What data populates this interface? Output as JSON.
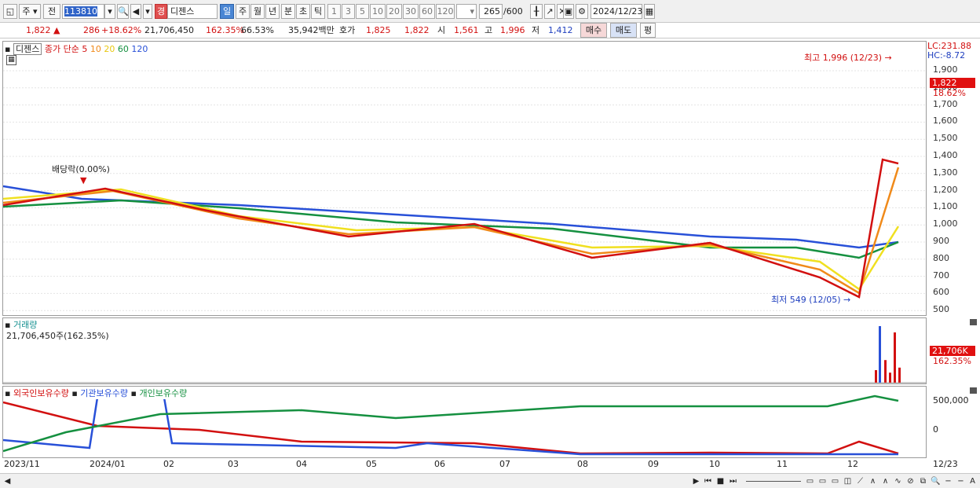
{
  "toolbar": {
    "mode1": "주",
    "mode2": "전",
    "code": "113810",
    "badge": "경",
    "stock_name": "디젠스",
    "periods": [
      "일",
      "주",
      "월",
      "년",
      "분",
      "초",
      "틱"
    ],
    "intervals": [
      "1",
      "3",
      "5",
      "10",
      "20",
      "30",
      "60",
      "120"
    ],
    "count": "265",
    "count_max": "/600",
    "date": "2024/12/23"
  },
  "quote": {
    "price": "1,822",
    "change": "286",
    "change_pct": "+18.62%",
    "volume": "21,706,450",
    "vol_ratio": "162.35%",
    "turnover": "66.53%",
    "amount": "35,942백만",
    "ask_label": "호가",
    "ask": "1,825",
    "bid": "1,822",
    "open_label": "시",
    "open": "1,561",
    "high_label": "고",
    "high": "1,996",
    "low_label": "저",
    "low": "1,412",
    "buy_btn": "매수",
    "sell_btn": "매도",
    "eval_btn": "평"
  },
  "price_pane": {
    "name_tag": "디젠스",
    "ma_title": "종가 단순",
    "ma_periods": [
      "5",
      "10",
      "20",
      "60",
      "120"
    ],
    "ma_colors": [
      "#d21010",
      "#f08a1a",
      "#f0e020",
      "#159040",
      "#2850d8"
    ],
    "lc": "LC:231.88",
    "hc": "HC:-8.72",
    "y_ticks": [
      "1,900",
      "1,800",
      "1,700",
      "1,600",
      "1,500",
      "1,400",
      "1,300",
      "1,200",
      "1,100",
      "1,000",
      "900",
      "800",
      "700",
      "600",
      "500"
    ],
    "high_note": "최고 1,996 (12/23)",
    "low_note": "최저 549 (12/05)",
    "dividend_note": "배당락(0.00%)",
    "last_price_tag": "1,822",
    "last_pct_tag": "18.62%"
  },
  "volume_pane": {
    "title": "거래량",
    "value": "21,706,450주(162.35%)",
    "last_tag": "21,706K",
    "last_pct": "162.35%"
  },
  "holdings_pane": {
    "series": [
      {
        "name": "외국인보유수량",
        "color": "#d21010"
      },
      {
        "name": "기관보유수량",
        "color": "#2850d8"
      },
      {
        "name": "개인보유수량",
        "color": "#159040"
      }
    ],
    "y_ticks": [
      "500,000",
      "0"
    ]
  },
  "x_axis": [
    "2023/11",
    "2024/01",
    "02",
    "03",
    "04",
    "05",
    "06",
    "07",
    "08",
    "09",
    "10",
    "11",
    "12",
    "12/23"
  ]
}
